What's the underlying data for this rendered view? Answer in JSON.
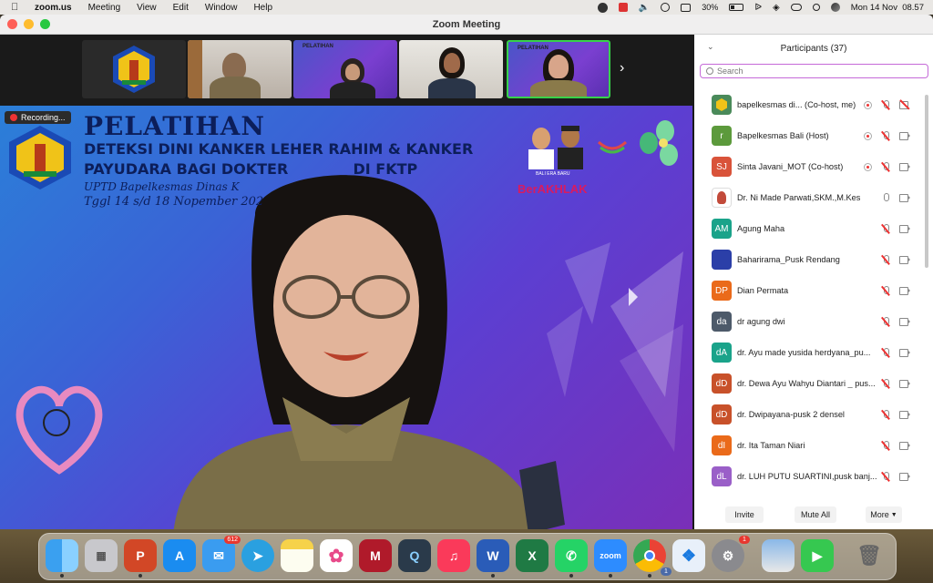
{
  "menubar": {
    "app": "zoom.us",
    "items": [
      "Meeting",
      "View",
      "Edit",
      "Window",
      "Help"
    ],
    "battery": "30%",
    "datetime": "Mon 14 Nov  08.57"
  },
  "window": {
    "title": "Zoom Meeting"
  },
  "recording": {
    "label": "Recording..."
  },
  "slide": {
    "title_line1": "PELATIHAN",
    "title_line2": "DETEKSI DINI KANKER LEHER RAHIM & KANKER",
    "title_line3": "PAYUDARA BAGI DOKTER",
    "title_line3b": "DI FKTP",
    "sub_line1": "UPTD Bapelkesmas Dinas K",
    "sub_line2": "Tggl 14 s/d 18 Nopember 202",
    "badge": "BerAKHLAK",
    "badge_small": "BALI ERA BARU"
  },
  "thumb5_title": "PELATIHAN",
  "thumb3_title": "PELATIHAN",
  "participants": {
    "header": "Participants (37)",
    "search_placeholder": "Search",
    "list": [
      {
        "initials": "",
        "name": "bapelkesmas di... (Co-host, me)",
        "color": "#4a8a5a"
      },
      {
        "initials": "r",
        "name": "Bapelkesmas Bali (Host)",
        "color": "#5c9a3c"
      },
      {
        "initials": "SJ",
        "name": "Sinta Javani_MOT (Co-host)",
        "color": "#d9533a"
      },
      {
        "initials": "",
        "name": "Dr. Ni Made Parwati,SKM.,M.Kes",
        "color": "#ffffff"
      },
      {
        "initials": "AM",
        "name": "Agung Maha",
        "color": "#1aa38a"
      },
      {
        "initials": "",
        "name": "Baharirama_Pusk Rendang",
        "color": "#2b3fa8"
      },
      {
        "initials": "DP",
        "name": "Dian Permata",
        "color": "#ea6a1a"
      },
      {
        "initials": "da",
        "name": "dr agung dwi",
        "color": "#4d5a6a"
      },
      {
        "initials": "dA",
        "name": "dr. Ayu made yusida herdyana_pu...",
        "color": "#1aa38a"
      },
      {
        "initials": "dD",
        "name": "dr. Dewa Ayu Wahyu Diantari _ pus...",
        "color": "#c8512a"
      },
      {
        "initials": "dD",
        "name": "dr. Dwipayana-pusk 2 densel",
        "color": "#c8512a"
      },
      {
        "initials": "dI",
        "name": "dr. Ita Taman Niari",
        "color": "#ea6a1a"
      },
      {
        "initials": "dL",
        "name": "dr. LUH PUTU SUARTINI,pusk banj...",
        "color": "#9a5fc8"
      }
    ]
  },
  "footer": {
    "invite": "Invite",
    "mute_all": "Mute All",
    "more": "More"
  },
  "dock": {
    "mail_badge": "612",
    "settings_badge": "1",
    "chrome_badge": "1"
  }
}
